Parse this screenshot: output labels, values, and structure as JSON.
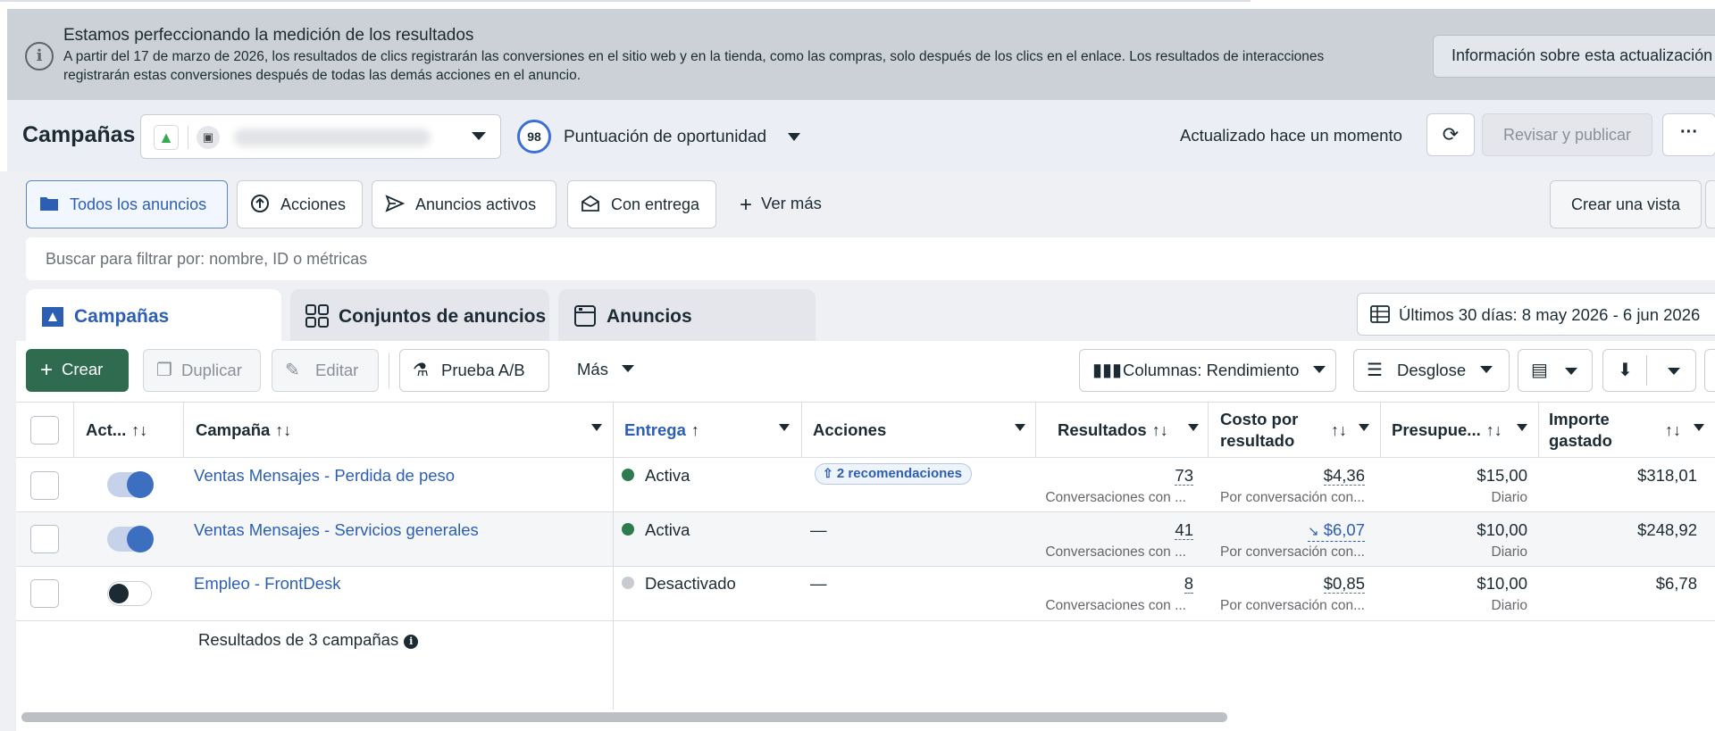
{
  "banner": {
    "title": "Estamos perfeccionando la medición de los resultados",
    "description": "A partir del 17 de marzo de 2026, los resultados de clics registrarán las conversiones en el sitio web y en la tienda, como las compras, solo después de los clics en el enlace. Los resultados de interacciones registrarán estas conversiones después de todas las demás acciones en el anuncio.",
    "button_label": "Información sobre esta actualización",
    "info_icon": "i"
  },
  "header": {
    "title": "Campañas",
    "score_value": "98",
    "score_label": "Puntuación de oportunidad",
    "updated_text": "Actualizado hace un momento",
    "publish_label": "Revisar y publicar",
    "more_label": "···"
  },
  "filters": {
    "chips": [
      {
        "label": "Todos los anuncios",
        "icon": "folder-icon"
      },
      {
        "label": "Acciones",
        "icon": "arrow-up-circle-icon"
      },
      {
        "label": "Anuncios activos",
        "icon": "send-icon"
      },
      {
        "label": "Con entrega",
        "icon": "envelope-icon"
      }
    ],
    "see_more": "Ver más",
    "create_view": "Crear una vista"
  },
  "search": {
    "placeholder": "Buscar para filtrar por: nombre, ID o métricas"
  },
  "tabs": [
    {
      "label": "Campañas",
      "icon": "campaign-icon",
      "active": true
    },
    {
      "label": "Conjuntos de anuncios",
      "icon": "grid-icon",
      "active": false
    },
    {
      "label": "Anuncios",
      "icon": "ad-icon",
      "active": false
    }
  ],
  "date_range": "Últimos 30 días: 8 may 2026 - 6 jun 2026",
  "toolbar": {
    "create": "Crear",
    "duplicate": "Duplicar",
    "edit": "Editar",
    "ab_test": "Prueba A/B",
    "more": "Más",
    "columns": "Columnas: Rendimiento",
    "breakdown": "Desglose"
  },
  "table": {
    "headers": {
      "active": "Act...",
      "campaign": "Campaña",
      "delivery": "Entrega",
      "actions": "Acciones",
      "results": "Resultados",
      "cost_line1": "Costo por",
      "cost_line2": "resultado",
      "budget": "Presupue...",
      "spent_line1": "Importe",
      "spent_line2": "gastado"
    },
    "sort_icon": "↑↓",
    "sort_up_icon": "↑",
    "rows": [
      {
        "toggle_on": true,
        "name": "Ventas Mensajes - Perdida de peso",
        "status": "Activa",
        "status_color": "#2f7a4f",
        "actions": "2 recomendaciones",
        "results": "73",
        "results_sub": "Conversaciones con ...",
        "cost": "$4,36",
        "cost_sub": "Por conversación con...",
        "budget": "$15,00",
        "budget_sub": "Diario",
        "spent": "$318,01"
      },
      {
        "toggle_on": true,
        "name": "Ventas Mensajes - Servicios generales",
        "status": "Activa",
        "status_color": "#2f7a4f",
        "actions": "—",
        "results": "41",
        "results_sub": "Conversaciones con ...",
        "cost": "$6,07",
        "cost_sub": "Por conversación con...",
        "budget": "$10,00",
        "budget_sub": "Diario",
        "spent": "$248,92"
      },
      {
        "toggle_on": false,
        "name": "Empleo - FrontDesk",
        "status": "Desactivado",
        "status_color": "#c8ccd1",
        "actions": "—",
        "results": "8",
        "results_sub": "Conversaciones con ...",
        "cost": "$0,85",
        "cost_sub": "Por conversación con...",
        "budget": "$10,00",
        "budget_sub": "Diario",
        "spent": "$6,78"
      }
    ],
    "footer": "Resultados de 3 campañas"
  },
  "colors": {
    "accent_blue": "#2c5fb4",
    "create_green": "#2f6b4f",
    "banner_bg": "#ccd1d7"
  }
}
